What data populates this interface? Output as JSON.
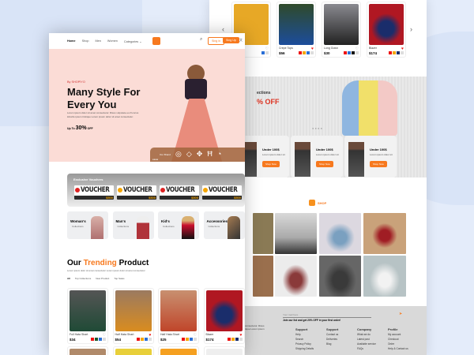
{
  "back_page": {
    "top_products": [
      {
        "name": "",
        "price": "",
        "swatches": [
          "#2a6fd6",
          "#ddd"
        ]
      },
      {
        "name": "Crepe Tops",
        "price": "$56",
        "swatches": [
          "#e11",
          "#f5a500",
          "#2a6fd6",
          "#ddd"
        ],
        "liked": true
      },
      {
        "name": "Long Gown",
        "price": "$30",
        "swatches": [
          "#e11",
          "#2a6fd6",
          "#111",
          "#ddd"
        ],
        "liked": false
      },
      {
        "name": "Blazer",
        "price": "$174",
        "swatches": [
          "#e11",
          "#f5a500",
          "#1a2d6b",
          "#ddd"
        ],
        "liked": true
      }
    ],
    "banner": {
      "subtitle": "ections",
      "offer": "% OFF"
    },
    "promo_cards": [
      {
        "title": "Under 100$",
        "text": "Lorem ipsum dolor sit",
        "button": "Shop Now"
      },
      {
        "title": "Under 100$",
        "text": "Lorem ipsum dolor sit",
        "button": "Shop Now"
      },
      {
        "title": "Under 100$",
        "text": "Lorem ipsum dolor sit",
        "button": "Shop Now"
      }
    ],
    "shop_label": "SHOP",
    "footer": {
      "email_placeholder": "Your mail here",
      "newsletter": "Join our list and get 20% OFF in your first order!",
      "about_lines": [
        "consectetur. Risus",
        "tique Lorem ipsum"
      ],
      "columns": [
        {
          "title": "Support",
          "items": [
            "Help",
            "Search",
            "Privacy Policy",
            "Shipping Details"
          ]
        },
        {
          "title": "Support",
          "items": [
            "Contact us",
            "Deliveries",
            "Blog"
          ]
        },
        {
          "title": "Company",
          "items": [
            "What we do",
            "Latest post",
            "Available service",
            "FAQs"
          ]
        },
        {
          "title": "Profile",
          "items": [
            "My account",
            "Checkout",
            "Order",
            "Help & Contact us"
          ]
        }
      ]
    }
  },
  "front_page": {
    "nav": {
      "items": [
        "Home",
        "Shop",
        "Men",
        "Women",
        "Categories"
      ],
      "sign_in": "Sing in",
      "sign_up": "Sing Up"
    },
    "hero": {
      "eyebrow": "By SHOPIYO",
      "title_line1": "Many Style For",
      "title_line2": "Every You",
      "text": "Lorem ipsum dolor sit amet consectetur. Risus vulputate eu rhoncus lobortis ipsum tristique Lorem ipsum dolor sit amet consectetur.",
      "offer_prefix": "Up To",
      "offer_value": "30%",
      "offer_suffix": "OFF",
      "brand_label": "Our Brand"
    },
    "vouchers": {
      "title": "Exclusive Vouchers",
      "items": [
        "VOUCHER",
        "VOUCHER",
        "VOUCHER",
        "VOUCHER"
      ],
      "amount": "$500"
    },
    "categories": [
      {
        "title": "Woman's",
        "sub": "Collections"
      },
      {
        "title": "Man's",
        "sub": "Collections"
      },
      {
        "title": "Kid's",
        "sub": "Collections"
      },
      {
        "title": "Accessories'",
        "sub": "Collections"
      }
    ],
    "trending": {
      "title_a": "Our",
      "title_b": "Trending",
      "title_c": "Product",
      "subtitle": "Lorem ipsum dolor sit amet consectetur Lorem ipsum dolor sit amet consectetur",
      "tabs": [
        "All",
        "Top Collections",
        "New Product",
        "Top Sales"
      ]
    },
    "products": [
      {
        "name": "Full Hata Shart",
        "price": "$34",
        "swatches": [
          "#e11",
          "#1d5a2c",
          "#2a6fd6",
          "#ddd"
        ],
        "liked": false
      },
      {
        "name": "Half Hata Shart",
        "price": "$54",
        "swatches": [
          "#e11",
          "#f5a500",
          "#2a6fd6",
          "#ddd"
        ],
        "liked": true
      },
      {
        "name": "Half Hata Shart",
        "price": "$25",
        "swatches": [
          "#e11",
          "#f5a500",
          "#2a6fd6",
          "#ddd"
        ],
        "liked": false
      },
      {
        "name": "Blazer",
        "price": "$174",
        "swatches": [
          "#e11",
          "#f5a500",
          "#1a2d6b",
          "#ddd"
        ],
        "liked": true
      }
    ]
  },
  "colors": {
    "accent": "#f7791e",
    "hero_bg": "#fbdcd6",
    "footer_bg": "#d9d9d9"
  }
}
